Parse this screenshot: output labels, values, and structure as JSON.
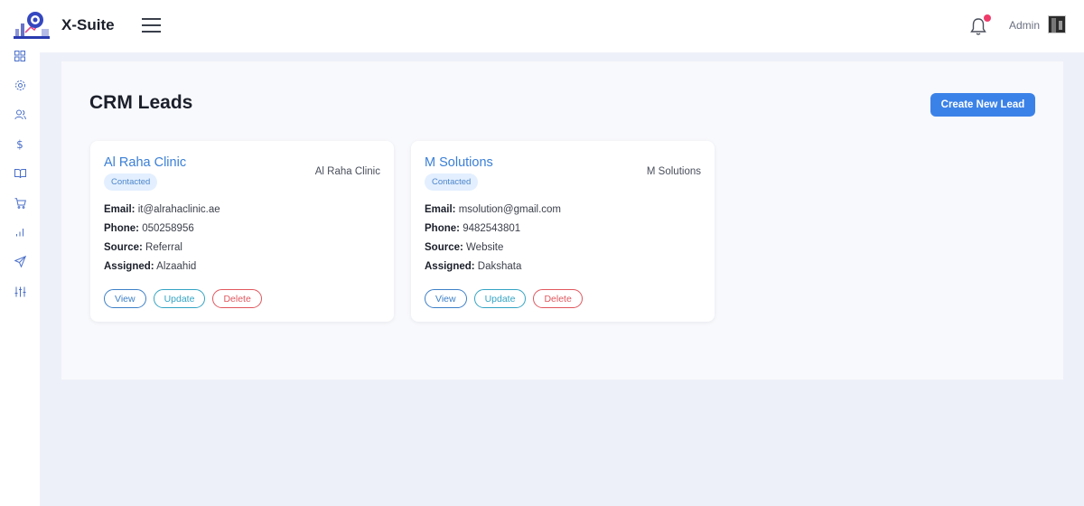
{
  "app": {
    "brand": "X-Suite"
  },
  "header": {
    "user_label": "Admin"
  },
  "sidebar": {
    "items": [
      {
        "icon": "grid-icon"
      },
      {
        "icon": "gear-icon"
      },
      {
        "icon": "users-icon"
      },
      {
        "icon": "dollar-icon"
      },
      {
        "icon": "book-icon"
      },
      {
        "icon": "cart-icon"
      },
      {
        "icon": "bar-chart-icon"
      },
      {
        "icon": "send-icon"
      },
      {
        "icon": "sliders-icon"
      }
    ]
  },
  "page": {
    "title": "CRM Leads",
    "create_label": "Create New Lead"
  },
  "labels": {
    "email": "Email:",
    "phone": "Phone:",
    "source": "Source:",
    "assigned": "Assigned:"
  },
  "actions": {
    "view": "View",
    "update": "Update",
    "delete": "Delete"
  },
  "leads": [
    {
      "name": "Al Raha Clinic",
      "company": "Al Raha Clinic",
      "status": "Contacted",
      "email": "it@alrahaclinic.ae",
      "phone": "050258956",
      "source": "Referral",
      "assigned": "Alzaahid"
    },
    {
      "name": "M Solutions",
      "company": "M Solutions",
      "status": "Contacted",
      "email": "msolution@gmail.com",
      "phone": "9482543801",
      "source": "Website",
      "assigned": "Dakshata"
    }
  ],
  "colors": {
    "accent": "#3b82e8",
    "notification": "#ef3b6a",
    "delete": "#e0575e"
  }
}
